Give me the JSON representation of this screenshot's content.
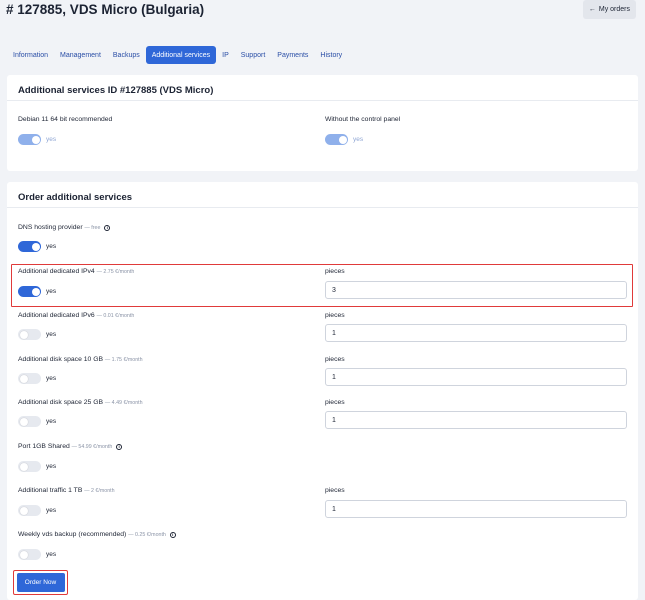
{
  "page": {
    "title": "# 127885, VDS Micro (Bulgaria)",
    "my_orders_label": "My orders",
    "my_orders_icon": "arrow-left-icon"
  },
  "tabs": [
    {
      "label": "Information",
      "active": false
    },
    {
      "label": "Management",
      "active": false
    },
    {
      "label": "Backups",
      "active": false
    },
    {
      "label": "Additional services",
      "active": true
    },
    {
      "label": "IP",
      "active": false
    },
    {
      "label": "Support",
      "active": false
    },
    {
      "label": "Payments",
      "active": false
    },
    {
      "label": "History",
      "active": false
    }
  ],
  "current_services": {
    "title": "Additional services ID #127885 (VDS Micro)",
    "items": [
      {
        "label": "Debian 11 64 bit recommended",
        "toggle_label": "yes",
        "enabled": true
      },
      {
        "label": "Without the control panel",
        "toggle_label": "yes",
        "enabled": true
      }
    ]
  },
  "order_services": {
    "title": "Order additional services",
    "pieces_label": "pieces",
    "items": [
      {
        "label": "DNS hosting provider",
        "price": "— free",
        "info": true,
        "toggle_label": "yes",
        "enabled": true
      },
      {
        "label": "Additional dedicated IPv4",
        "price": "— 2.75 €/month",
        "toggle_label": "yes",
        "enabled": true,
        "pieces": "3"
      },
      {
        "label": "Additional dedicated IPv6",
        "price": "— 0.01 €/month",
        "toggle_label": "yes",
        "enabled": false,
        "pieces": "1"
      },
      {
        "label": "Additional disk space 10 GB",
        "price": "— 1.75 €/month",
        "toggle_label": "yes",
        "enabled": false,
        "pieces": "1"
      },
      {
        "label": "Additional disk space 25 GB",
        "price": "— 4.49 €/month",
        "toggle_label": "yes",
        "enabled": false,
        "pieces": "1"
      },
      {
        "label": "Port 1GB Shared",
        "price": "— 54.99 €/month",
        "info": true,
        "toggle_label": "yes",
        "enabled": false
      },
      {
        "label": "Additional traffic 1 TB",
        "price": "— 2 €/month",
        "toggle_label": "yes",
        "enabled": false,
        "pieces": "1"
      },
      {
        "label": "Weekly vds backup (recommended)",
        "price": "— 0.25 €/month",
        "info": true,
        "toggle_label": "yes",
        "enabled": false
      }
    ],
    "order_button": "Order Now"
  },
  "colors": {
    "accent": "#2f67d8",
    "highlight": "#e03a3a",
    "background": "#f1f3f7"
  }
}
